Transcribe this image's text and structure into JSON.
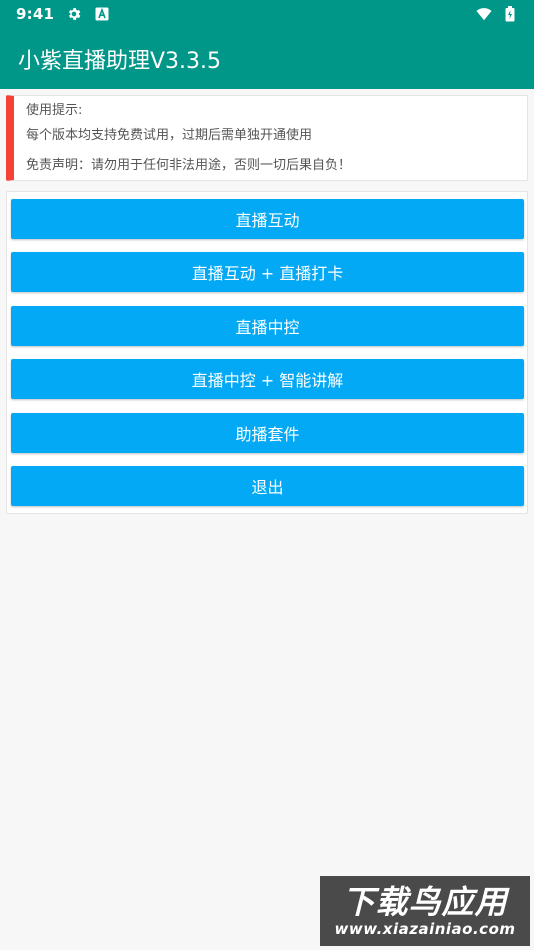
{
  "status_bar": {
    "time": "9:41",
    "icons": [
      "gear-icon",
      "a-badge-icon",
      "wifi-icon",
      "battery-icon"
    ]
  },
  "app_bar": {
    "title": "小紫直播助理V3.3.5",
    "color": "#009688"
  },
  "notice": {
    "title": "使用提示:",
    "desc": "每个版本均支持免费试用，过期后需单独开通使用",
    "disclaimer": "免责声明：请勿用于任何非法用途，否则一切后果自负！",
    "accent_color": "#f44336"
  },
  "buttons": [
    {
      "label": "直播互动"
    },
    {
      "label": "直播互动 + 直播打卡"
    },
    {
      "label": "直播中控"
    },
    {
      "label": "直播中控 + 智能讲解"
    },
    {
      "label": "助播套件"
    },
    {
      "label": "退出"
    }
  ],
  "button_color": "#03a9f4",
  "watermark": {
    "title": "下载鸟应用",
    "url": "www.xiazainiao.com"
  }
}
